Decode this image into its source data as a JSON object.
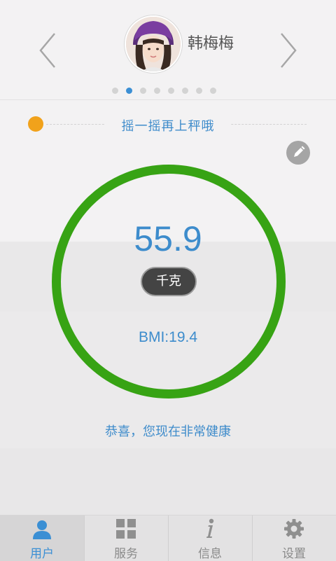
{
  "profile": {
    "name": "韩梅梅",
    "page_count": 8,
    "active_page": 2
  },
  "tip": {
    "text": "摇一摇再上秤哦",
    "indicator_color": "#f1a21b"
  },
  "measurement": {
    "weight": "55.9",
    "unit": "千克",
    "bmi": "BMI:19.4",
    "ring_color": "#37a314"
  },
  "health_message": "恭喜，您现在非常健康",
  "tabbar": {
    "active": "user",
    "tabs": [
      {
        "id": "user",
        "label": "用户",
        "icon": "user-icon"
      },
      {
        "id": "service",
        "label": "服务",
        "icon": "grid-icon"
      },
      {
        "id": "info",
        "label": "信息",
        "icon": "info-icon"
      },
      {
        "id": "settings",
        "label": "设置",
        "icon": "gear-icon"
      }
    ]
  },
  "colors": {
    "accent": "#3b8fd4",
    "text_blue": "#3d8ccc"
  }
}
